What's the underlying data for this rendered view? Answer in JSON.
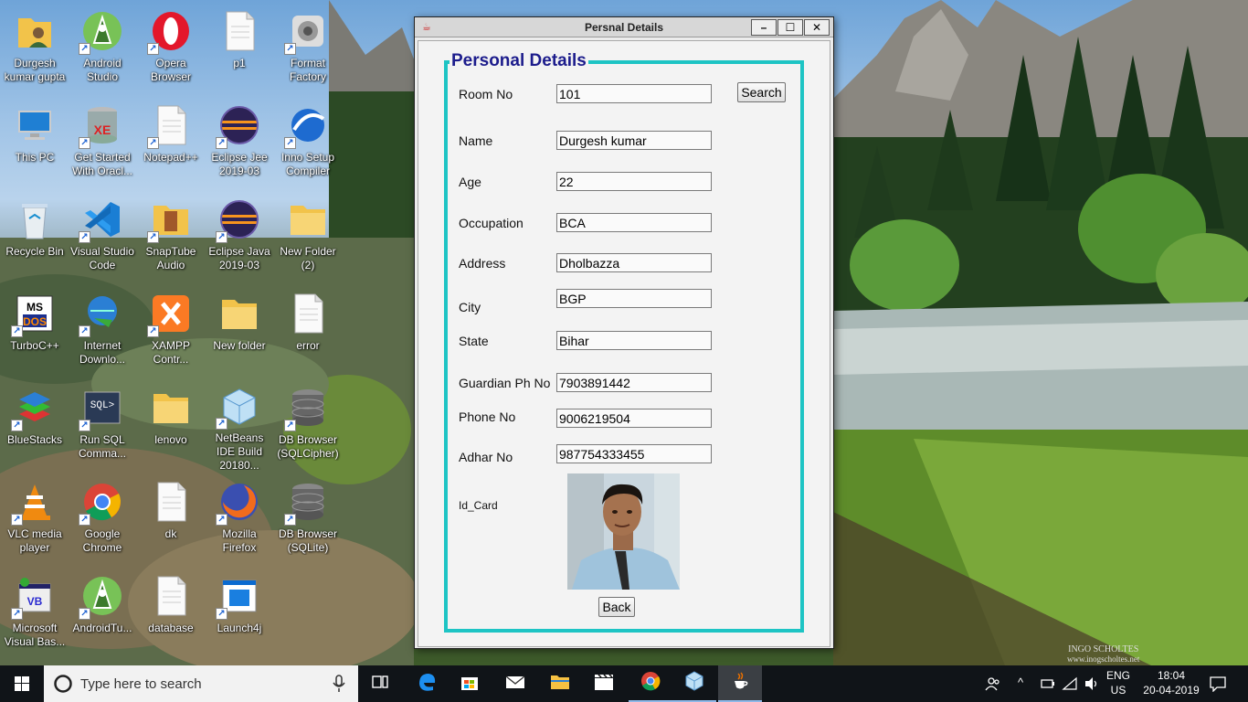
{
  "desktop": {
    "icons": [
      {
        "label": "Durgesh kumar gupta",
        "icon": "user-folder-icon"
      },
      {
        "label": "Android Studio",
        "icon": "android-studio-icon"
      },
      {
        "label": "Opera Browser",
        "icon": "opera-icon"
      },
      {
        "label": "p1",
        "icon": "file-icon"
      },
      {
        "label": "Format Factory",
        "icon": "format-factory-icon"
      },
      {
        "label": "This PC",
        "icon": "computer-icon"
      },
      {
        "label": "Get Started With Oracl...",
        "icon": "oracle-database-icon"
      },
      {
        "label": "Notepad++",
        "icon": "file-icon"
      },
      {
        "label": "Eclipse Jee 2019-03",
        "icon": "eclipse-icon"
      },
      {
        "label": "Inno Setup Compiler",
        "icon": "inno-setup-icon"
      },
      {
        "label": "Recycle Bin",
        "icon": "recycle-bin-icon"
      },
      {
        "label": "Visual Studio Code",
        "icon": "vscode-icon"
      },
      {
        "label": "SnapTube Audio",
        "icon": "snaptube-icon"
      },
      {
        "label": "Eclipse Java 2019-03",
        "icon": "eclipse-icon"
      },
      {
        "label": "New Folder (2)",
        "icon": "folder-icon"
      },
      {
        "label": "TurboC++",
        "icon": "turbo-c-icon"
      },
      {
        "label": "Internet Downlo...",
        "icon": "idm-icon"
      },
      {
        "label": "XAMPP Contr...",
        "icon": "xampp-icon"
      },
      {
        "label": "New folder",
        "icon": "folder-icon"
      },
      {
        "label": "error",
        "icon": "file-icon"
      },
      {
        "label": "BlueStacks",
        "icon": "bluestacks-icon"
      },
      {
        "label": "Run SQL Comma...",
        "icon": "sql-icon"
      },
      {
        "label": "lenovo",
        "icon": "folder-icon"
      },
      {
        "label": "NetBeans IDE Build 20180...",
        "icon": "netbeans-icon"
      },
      {
        "label": "DB Browser (SQLCipher)",
        "icon": "db-browser-icon"
      },
      {
        "label": "VLC media player",
        "icon": "vlc-icon"
      },
      {
        "label": "Google Chrome",
        "icon": "chrome-icon"
      },
      {
        "label": "dk",
        "icon": "file-icon"
      },
      {
        "label": "Mozilla Firefox",
        "icon": "firefox-icon"
      },
      {
        "label": "DB Browser (SQLite)",
        "icon": "db-browser-icon"
      },
      {
        "label": "Microsoft Visual Bas...",
        "icon": "visual-basic-icon"
      },
      {
        "label": "AndroidTu...",
        "icon": "android-studio-icon"
      },
      {
        "label": "database",
        "icon": "file-icon"
      },
      {
        "label": "Launch4j",
        "icon": "launch4j-icon"
      }
    ]
  },
  "window": {
    "title": "Persnal Details",
    "minimize": "–",
    "maximize": "☐",
    "close": "✕"
  },
  "form": {
    "panel_title": "Personal Details",
    "room_no": {
      "label": "Room No",
      "value": "101"
    },
    "search_button": "Search",
    "name": {
      "label": "Name",
      "value": "Durgesh kumar"
    },
    "age": {
      "label": "Age",
      "value": "22"
    },
    "occupation": {
      "label": "Occupation",
      "value": "BCA"
    },
    "address": {
      "label": "Address",
      "value": "Dholbazza"
    },
    "city": {
      "label": "City",
      "value": "BGP"
    },
    "state": {
      "label": "State",
      "value": "Bihar"
    },
    "guardian_ph": {
      "label": "Guardian Ph No",
      "value": "7903891442"
    },
    "phone_no": {
      "label": "Phone No",
      "value": "9006219504"
    },
    "adhar_no": {
      "label": "Adhar No",
      "value": "987754333455"
    },
    "id_card_label": "Id_Card",
    "back_button": "Back"
  },
  "taskbar": {
    "search_placeholder": "Type here to search",
    "apps": [
      "task-view-icon",
      "edge-icon",
      "store-icon",
      "mail-icon",
      "file-explorer-icon",
      "movies-icon",
      "chrome-icon",
      "netbeans-icon",
      "java-icon"
    ],
    "language": "ENG",
    "region": "US",
    "time": "18:04",
    "date": "20-04-2019"
  },
  "watermark": {
    "line1": "INGO SCHOLTES",
    "line2": "www.inogscholtes.net"
  }
}
